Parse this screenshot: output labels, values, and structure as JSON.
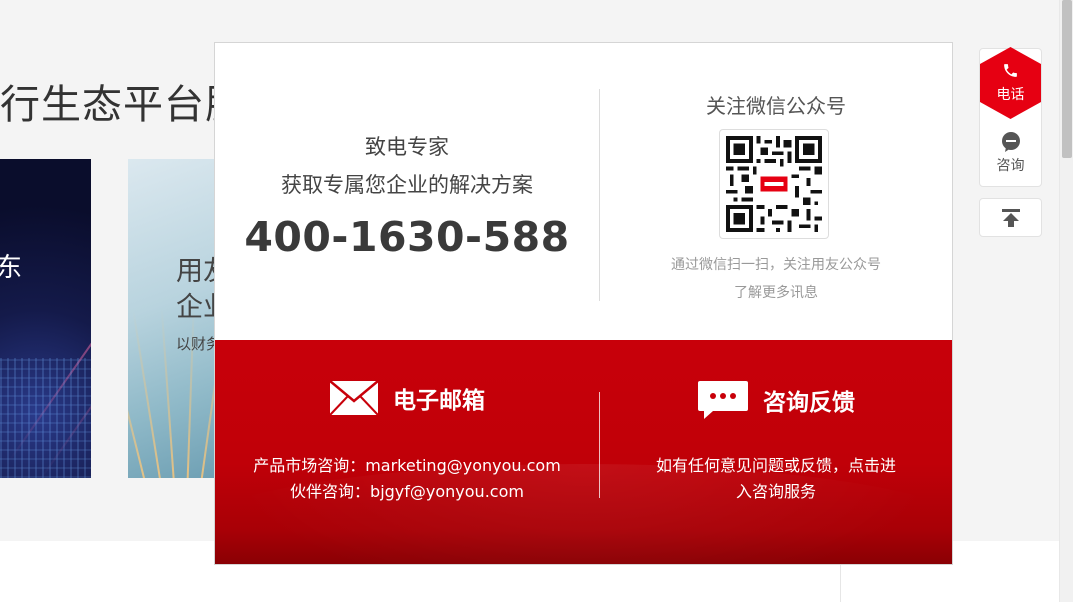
{
  "background": {
    "heading_fragment": "行生态平台服",
    "dark_card_char": "东",
    "light_card": {
      "line1": "用友",
      "line2": "企业",
      "line3": "以财务"
    }
  },
  "popup": {
    "phone_section": {
      "title": "致电专家",
      "subtitle": "获取专属您企业的解决方案",
      "number": "400-1630-588"
    },
    "wechat_section": {
      "title": "关注微信公众号",
      "qr_icon": "qr-code",
      "desc_line1": "通过微信扫一扫，关注用友公众号",
      "desc_line2": "了解更多讯息"
    },
    "email_section": {
      "icon": "envelope-icon",
      "title": "电子邮箱",
      "line1": "产品市场咨询：marketing@yonyou.com",
      "line2": "伙伴咨询：bjgyf@yonyou.com"
    },
    "feedback_section": {
      "icon": "chat-bubble-icon",
      "title": "咨询反馈",
      "line1": "如有任何意见问题或反馈，点击进",
      "line2": "入咨询服务"
    },
    "colors": {
      "primary_red": "#c8000a",
      "hex_red": "#e60012"
    }
  },
  "toolbar": {
    "phone_label": "电话",
    "consult_label": "咨询",
    "back_to_top_icon": "arrow-up-to-line-icon"
  }
}
